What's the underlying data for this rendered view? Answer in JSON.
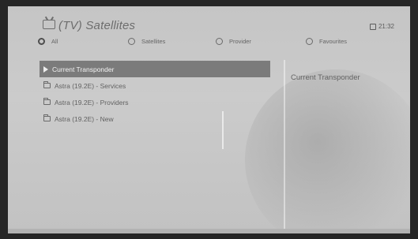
{
  "header": {
    "title": "(TV) Satellites",
    "time": "21:32"
  },
  "filters": [
    {
      "label": "All",
      "selected": true
    },
    {
      "label": "Satellites",
      "selected": false
    },
    {
      "label": "Provider",
      "selected": false
    },
    {
      "label": "Favourites",
      "selected": false
    }
  ],
  "list": {
    "items": [
      {
        "label": "Current Transponder",
        "icon": "play-icon",
        "selected": true
      },
      {
        "label": "Astra (19.2E) - Services",
        "icon": "folder-icon",
        "selected": false
      },
      {
        "label": "Astra (19.2E) - Providers",
        "icon": "folder-icon",
        "selected": false
      },
      {
        "label": "Astra (19.2E) - New",
        "icon": "folder-icon",
        "selected": false
      }
    ]
  },
  "info_panel": {
    "title": "Current Transponder"
  }
}
